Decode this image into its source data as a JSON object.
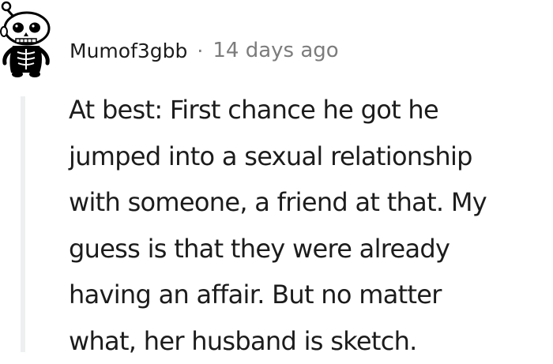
{
  "comment": {
    "author": "Mumof3gbb",
    "separator": "·",
    "timestamp": "14 days ago",
    "avatar_icon": "snoo-avatar-icon",
    "body_lines": [
      "At best: First chance he got he",
      "jumped into a sexual relationship",
      "with someone, a friend at that. My",
      "guess is that they were already",
      "having an affair. But no matter",
      "what, her husband is sketch."
    ]
  },
  "colors": {
    "text": "#1c1c1c",
    "meta": "#7c7c7c",
    "thread_line": "#edeff1"
  }
}
